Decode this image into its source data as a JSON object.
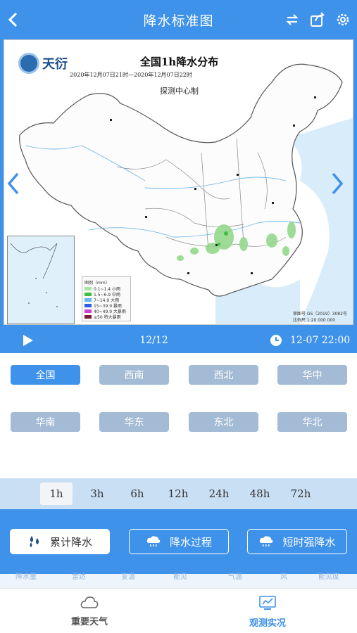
{
  "header": {
    "title": "降水标准图"
  },
  "map": {
    "title": "全国1h降水分布",
    "subtitle": "2020年12月07日21时—2020年12月07日22时",
    "author": "探测中心制",
    "logo_text": "天衍",
    "legend_title": "图例（mm）",
    "legend_items": [
      {
        "label": "0.1~1.4 小雨",
        "color": "#a8e6a0"
      },
      {
        "label": "1.5~6.9 中雨",
        "color": "#3fbf3f"
      },
      {
        "label": "7~14.9 大雨",
        "color": "#64b8f0"
      },
      {
        "label": "15~39.9 暴雨",
        "color": "#2f5fe0"
      },
      {
        "label": "40~49.9 大暴雨",
        "color": "#d040d0"
      },
      {
        "label": "≥50 特大暴雨",
        "color": "#7a1a3a"
      }
    ],
    "scale_text": "审图号 GS（2019）3082号",
    "scale_ratio": "比例尺 1:20 000 000"
  },
  "player": {
    "frame": "12/12",
    "time": "12-07 22:00"
  },
  "regions": [
    {
      "label": "全国",
      "active": true
    },
    {
      "label": "西南",
      "active": false
    },
    {
      "label": "西北",
      "active": false
    },
    {
      "label": "华中",
      "active": false
    },
    {
      "label": "华南",
      "active": false
    },
    {
      "label": "华东",
      "active": false
    },
    {
      "label": "东北",
      "active": false
    },
    {
      "label": "华北",
      "active": false
    }
  ],
  "durations": [
    "1h",
    "3h",
    "6h",
    "12h",
    "24h",
    "48h",
    "72h"
  ],
  "active_duration": "1h",
  "modes": [
    {
      "label": "累计降水",
      "active": true
    },
    {
      "label": "降水过程",
      "active": false
    },
    {
      "label": "短时强降水",
      "active": false
    }
  ],
  "strip": [
    "降水量",
    "雷达",
    "变温",
    "能见",
    "气温",
    "风",
    "能见度"
  ],
  "tabs": [
    {
      "label": "重要天气",
      "active": false
    },
    {
      "label": "观测实况",
      "active": true
    }
  ],
  "colors": {
    "primary": "#3f92ea",
    "inactive_region": "#a4bbd6"
  }
}
